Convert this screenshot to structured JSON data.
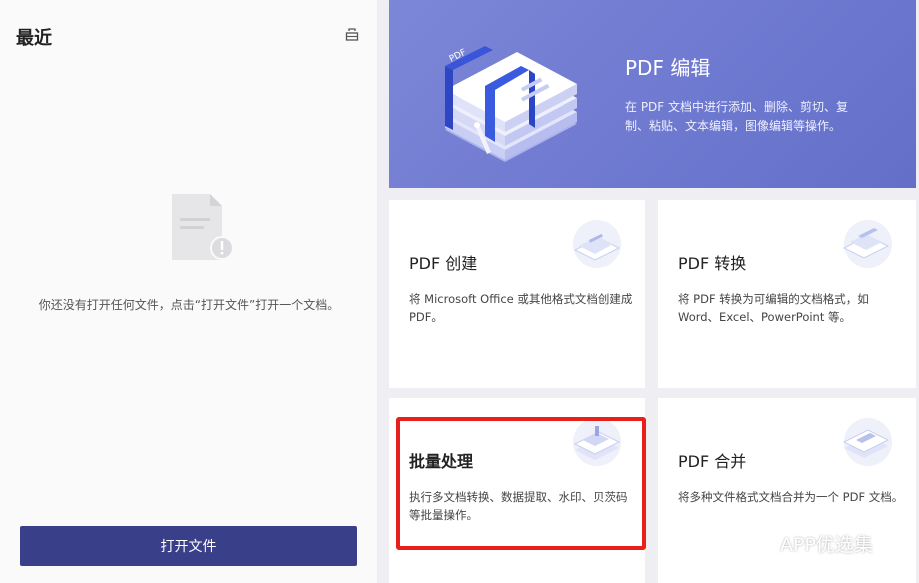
{
  "left": {
    "title": "最近",
    "empty_message": "你还没有打开任何文件，点击“打开文件”打开一个文档。",
    "open_button": "打开文件"
  },
  "hero": {
    "title": "PDF 编辑",
    "description": "在 PDF 文档中进行添加、删除、剪切、复制、粘贴、文本编辑，图像编辑等操作。",
    "art_label": "PDF"
  },
  "cards": [
    {
      "title": "PDF 创建",
      "description": "将 Microsoft Office 或其他格式文档创建成 PDF。"
    },
    {
      "title": "PDF 转换",
      "description": "将 PDF 转换为可编辑的文档格式，如 Word、Excel、PowerPoint 等。"
    },
    {
      "title": "批量处理",
      "description": "执行多文档转换、数据提取、水印、贝茨码等批量操作。"
    },
    {
      "title": "PDF 合并",
      "description": "将多种文件格式文档合并为一个 PDF 文档。"
    }
  ],
  "watermark": {
    "text": "APP优选集"
  },
  "colors": {
    "hero_bg": "#7c87d8",
    "open_button": "#3a3f8a",
    "highlight": "#e8201c"
  }
}
